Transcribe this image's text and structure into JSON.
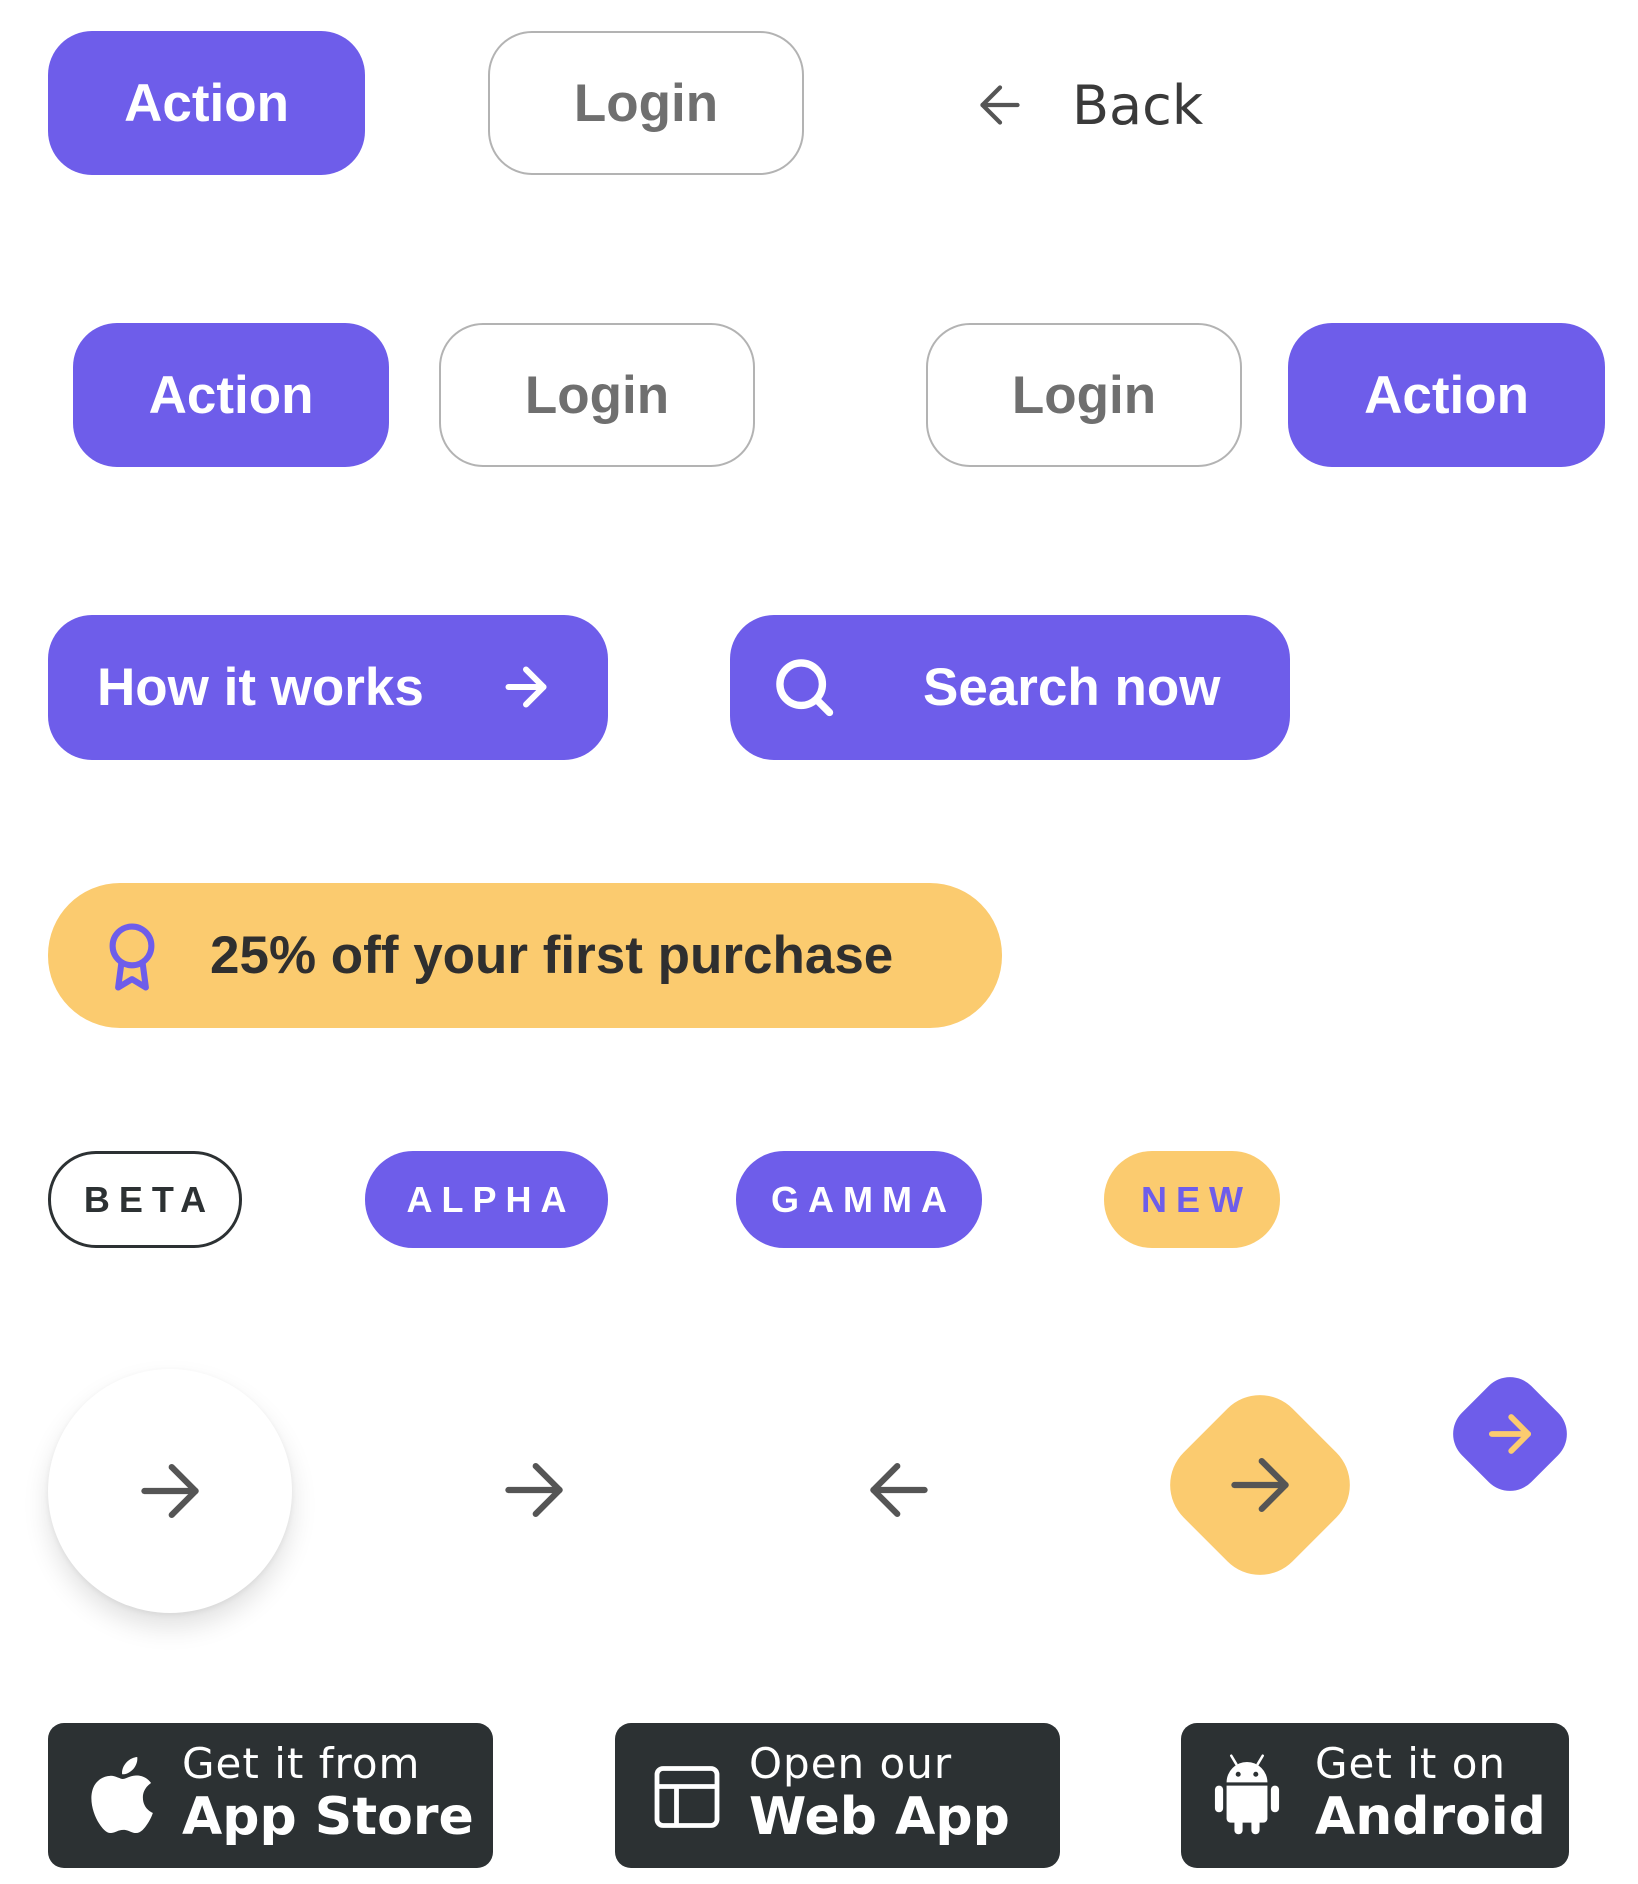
{
  "row1": {
    "action_label": "Action",
    "login_label": "Login",
    "back_label": "Back"
  },
  "row2": {
    "action1_label": "Action",
    "login1_label": "Login",
    "login2_label": "Login",
    "action2_label": "Action"
  },
  "row3": {
    "how_it_works_label": "How it works",
    "search_now_label": "Search now"
  },
  "promo": {
    "label": "25% off your first purchase"
  },
  "badges": {
    "beta": "BETA",
    "alpha": "ALPHA",
    "gamma": "GAMMA",
    "new": "NEW"
  },
  "stores": {
    "app_store": {
      "line1": "Get it from",
      "line2": "App Store"
    },
    "web_app": {
      "line1": "Open our",
      "line2": "Web App"
    },
    "android": {
      "line1": "Get it on",
      "line2": "Android"
    }
  },
  "icons": {
    "back": "arrow-left-icon",
    "how_it_works": "arrow-right-icon",
    "search": "search-icon",
    "promo": "award-ribbon-icon",
    "app_store": "apple-icon",
    "web_app": "browser-window-icon",
    "android": "android-icon"
  },
  "colors": {
    "primary": "#6E5DEA",
    "accent_yellow": "#FBCB6F",
    "dark": "#2C3133",
    "outline_grey": "#B3B3B3",
    "icon_grey": "#555555"
  }
}
